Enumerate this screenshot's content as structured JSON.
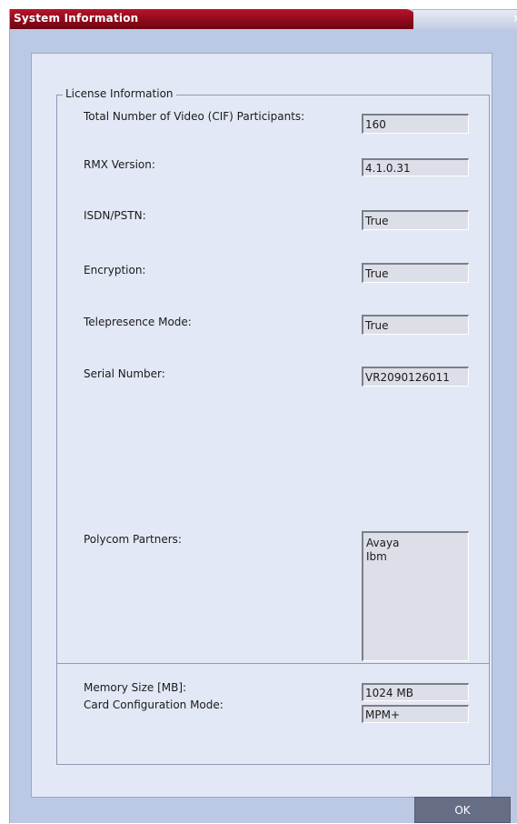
{
  "window": {
    "title": "System Information",
    "close_glyph": "×"
  },
  "license_group": {
    "legend": "License Information",
    "fields": [
      {
        "label": "Total Number of Video (CIF) Participants:",
        "value": "160"
      },
      {
        "label": "RMX Version:",
        "value": "4.1.0.31"
      },
      {
        "label": "ISDN/PSTN:",
        "value": "True"
      },
      {
        "label": "Encryption:",
        "value": "True"
      },
      {
        "label": "Telepresence Mode:",
        "value": "True"
      },
      {
        "label": "Serial Number:",
        "value": "VR2090126011"
      }
    ],
    "partners": {
      "label": "Polycom Partners:",
      "items": [
        "Avaya",
        "Ibm"
      ]
    }
  },
  "system_group": {
    "fields": [
      {
        "label": "Memory Size [MB]:",
        "value": "1024 MB"
      },
      {
        "label": "Card Configuration Mode:",
        "value": "MPM+"
      }
    ]
  },
  "footer": {
    "ok_label": "OK"
  },
  "colors": {
    "title_bar": "#8e0a1b",
    "window_bg": "#bcc9e4",
    "panel_bg": "#e3e8f6",
    "field_bg": "#dcdfe8",
    "ok_button": "#656e85"
  }
}
